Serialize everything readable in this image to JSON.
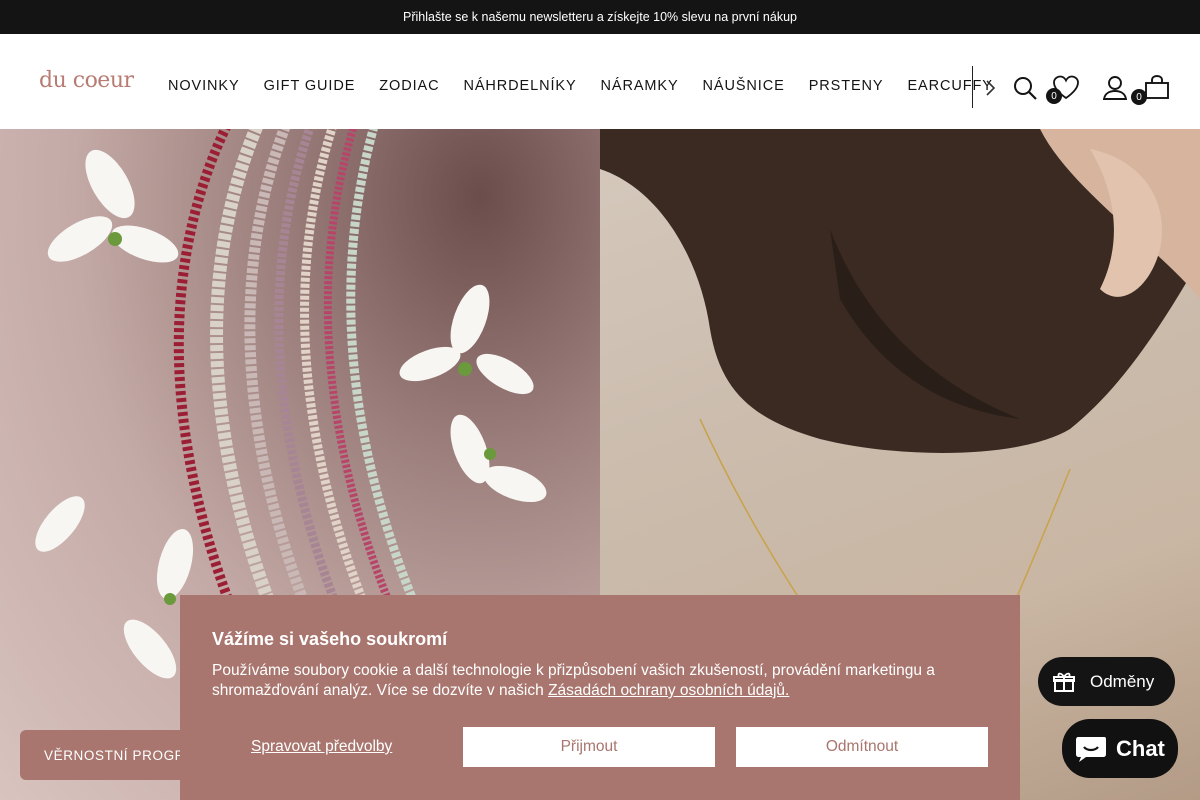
{
  "announcement": {
    "text": "Přihlašte se k našemu newsletteru a získejte 10% slevu na první nákup"
  },
  "header": {
    "logo": "du coeur",
    "nav": [
      "NOVINKY",
      "GIFT GUIDE",
      "ZODIAC",
      "NÁHRDELNÍKY",
      "NÁRAMKY",
      "NÁUŠNICE",
      "PRSTENY",
      "EARCUFFY"
    ],
    "wishlist_count": "0",
    "cart_count": "0",
    "icons": [
      "chevron-right-icon",
      "search-icon",
      "heart-icon",
      "user-icon",
      "bag-icon"
    ]
  },
  "cookie": {
    "title": "Vážíme si vašeho soukromí",
    "text": "Používáme soubory cookie a další technologie k přizpůsobení vašich zkušeností, provádění marketingu a shromažďování analýz. Více se dozvíte v našich ",
    "link": "Zásadách ochrany osobních údajů.",
    "manage": "Spravovat předvolby",
    "accept": "Přijmout",
    "decline": "Odmítnout"
  },
  "loyalty": {
    "label": "VĚRNOSTNÍ PROGRAM"
  },
  "rewards": {
    "label": "Odměny"
  },
  "chat": {
    "label": "Chat"
  },
  "colors": {
    "accent": "#a8766e",
    "dark": "#141414",
    "logo": "#b77c73"
  }
}
